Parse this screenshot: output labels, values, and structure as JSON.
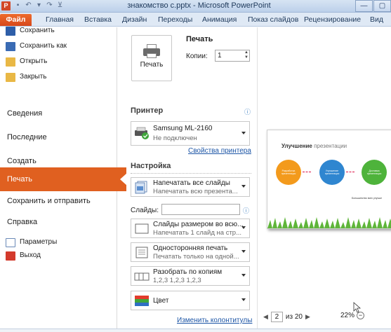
{
  "window": {
    "title": "знакомство с.pptx - Microsoft PowerPoint",
    "app_icon_letter": "P",
    "controls": [
      "minimize-icon",
      "maximize-icon"
    ]
  },
  "ribbon": {
    "tabs": [
      "Файл",
      "Главная",
      "Вставка",
      "Дизайн",
      "Переходы",
      "Анимация",
      "Показ слайдов",
      "Рецензирование",
      "Вид"
    ]
  },
  "nav": {
    "commands": [
      {
        "label": "Сохранить",
        "icon": "save-icon",
        "color": "#2e5ea8"
      },
      {
        "label": "Сохранить как",
        "icon": "save-as-icon",
        "color": "#3a6bb4"
      },
      {
        "label": "Открыть",
        "icon": "open-folder-icon",
        "color": "#e9b845"
      },
      {
        "label": "Закрыть",
        "icon": "close-folder-icon",
        "color": "#e9b845"
      }
    ],
    "items": [
      {
        "label": "Сведения"
      },
      {
        "label": "Последние"
      },
      {
        "label": "Создать"
      },
      {
        "label": "Печать",
        "active": true
      },
      {
        "label": "Сохранить и отправить"
      },
      {
        "label": "Справка"
      }
    ],
    "footer": [
      {
        "label": "Параметры",
        "icon": "options-icon"
      },
      {
        "label": "Выход",
        "icon": "exit-icon"
      }
    ],
    "accent": "#e06020"
  },
  "print": {
    "heading": "Печать",
    "button_label": "Печать",
    "copies_label": "Копии:",
    "copies_value": "1",
    "printer_heading": "Принтер",
    "printer_name": "Samsung ML-2160",
    "printer_status": "Не подключен",
    "printer_props_link": "Свойства принтера",
    "settings_heading": "Настройка",
    "range_title": "Напечатать все слайды",
    "range_sub": "Напечатать всю презента...",
    "slides_label": "Слайды:",
    "slides_value": "",
    "layout_title": "Слайды размером во всю...",
    "layout_sub": "Напечатать 1 слайд на стр...",
    "sides_title": "Односторонняя печать",
    "sides_sub": "Печатать только на одной...",
    "collate_title": "Разобрать по копиям",
    "collate_sub": "1,2,3   1,2,3   1,2,3",
    "color_title": "Цвет",
    "headers_link": "Изменить колонтитулы"
  },
  "preview": {
    "slide_title_bold": "Улучшение",
    "slide_title_rest": " презентации",
    "circles": [
      {
        "text": "Разработка презентации",
        "color": "#f39a1c"
      },
      {
        "text": "Улучшение презентации",
        "color": "#2f86d0"
      },
      {
        "text": "Доставка презентации",
        "color": "#4eb33b"
      }
    ],
    "footer_text": "Большинство всех улучше",
    "page_current": "2",
    "page_total": "из 20",
    "zoom": "22%"
  }
}
